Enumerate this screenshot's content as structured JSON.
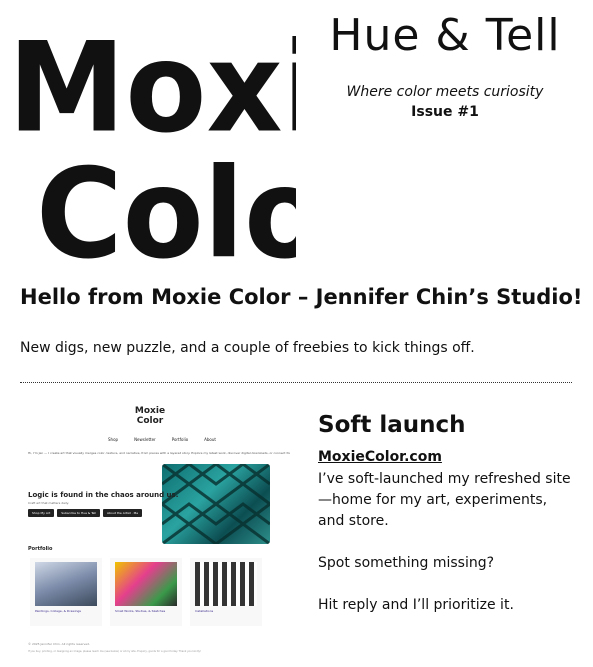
{
  "logo": {
    "line1": "Moxie",
    "line2": "Color"
  },
  "masthead": {
    "title": "Hue & Tell",
    "tagline": "Where color meets curiosity",
    "issue": "Issue #1"
  },
  "hero": {
    "heading": "Hello from Moxie Color – Jennifer Chin’s Studio!",
    "text": "New digs, new puzzle, and a couple of freebies to kick things off."
  },
  "site_preview": {
    "logo": "Moxie Color",
    "nav": [
      "Shop",
      "Newsletter",
      "Portfolio",
      "About"
    ],
    "intro": "Hi, I'm Jen — I create art that visually merges color, texture, and narrative, from pieces with a layered story. Explore my latest work, discover digital downloads, or connect for collaborations.",
    "headline": "Logic is found in the chaos around us.",
    "subline": "Craft art that matters daily.",
    "buttons": [
      "Shop My Art",
      "Subscribe to Hue & Tell",
      "About the Artist · Me"
    ],
    "portfolio_label": "Portfolio",
    "cards": [
      {
        "caption": "Paintings, Collage, & Drawings"
      },
      {
        "caption": "Small Works, Studies, & Sketches"
      },
      {
        "caption": "Installations"
      }
    ],
    "footer_line1": "© 2025 Jennifer Chin. All rights reserved.",
    "footer_line2": "If you buy, printing, or designing an image, please reach me (see below) or at my site. Enquiry, goods for a good today. Thank you kindly!"
  },
  "soft_launch": {
    "heading": "Soft launch",
    "link": "MoxieColor.com",
    "p1": "I’ve soft-launched my refreshed site—home for my art, experiments, and store.",
    "p2": "Spot something missing?",
    "p3": "Hit reply and I’ll prioritize it."
  }
}
